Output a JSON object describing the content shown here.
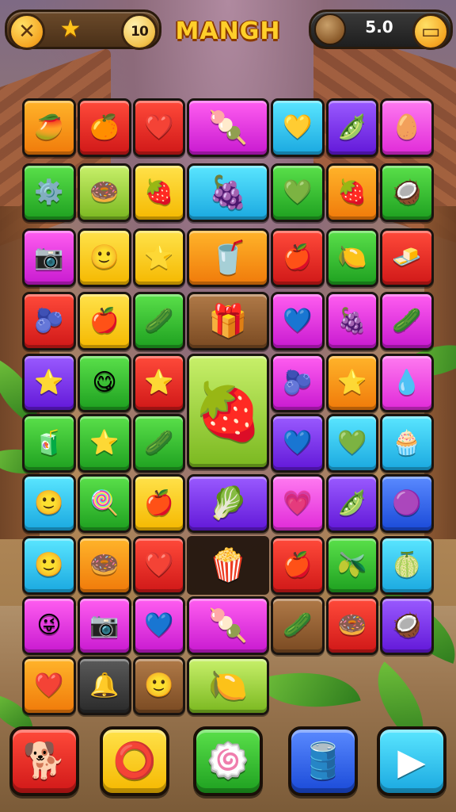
{
  "hud": {
    "close_icon": "✕",
    "star_icon": "★",
    "level": "10",
    "title": "MANGH",
    "coins": "5.0",
    "menu_icon": "▭"
  },
  "board": {
    "tiles": [
      {
        "id": "r1c1",
        "color": "orange",
        "glyph": "🥭",
        "icon": "mango-slice-icon"
      },
      {
        "id": "r1c2",
        "color": "red",
        "glyph": "🍊",
        "icon": "orange-fruit-icon"
      },
      {
        "id": "r1c3",
        "color": "red",
        "glyph": "❤️",
        "icon": "heart-icon"
      },
      {
        "id": "r1c4",
        "color": "magenta",
        "glyph": "🍡",
        "icon": "sushi-plate-icon",
        "span": "wide"
      },
      {
        "id": "r1c5",
        "color": "cyan",
        "glyph": "💛",
        "icon": "yellow-heart-icon"
      },
      {
        "id": "r1c6",
        "color": "purple",
        "glyph": "🫛",
        "icon": "pea-pod-icon"
      },
      {
        "id": "r1c7",
        "color": "pink",
        "glyph": "🥚",
        "icon": "egg-icon"
      },
      {
        "id": "r2c1",
        "color": "green",
        "glyph": "⚙️",
        "icon": "gear-device-icon"
      },
      {
        "id": "r2c2",
        "color": "lime",
        "glyph": "🍩",
        "icon": "donut-icon"
      },
      {
        "id": "r2c3",
        "color": "yellow",
        "glyph": "🍓",
        "icon": "jam-toast-icon"
      },
      {
        "id": "r2c4",
        "color": "cyan",
        "glyph": "🍇",
        "icon": "plum-icon",
        "span": "wide"
      },
      {
        "id": "r2c5",
        "color": "green",
        "glyph": "💚",
        "icon": "green-heart-icon"
      },
      {
        "id": "r2c6",
        "color": "orange",
        "glyph": "🍓",
        "icon": "strawberry-icon"
      },
      {
        "id": "r2c7",
        "color": "green",
        "glyph": "🥥",
        "icon": "coconut-icon"
      },
      {
        "id": "r3c1",
        "color": "magenta",
        "glyph": "📷",
        "icon": "camera-icon"
      },
      {
        "id": "r3c2",
        "color": "yellow",
        "glyph": "🙂",
        "icon": "smiley-icon"
      },
      {
        "id": "r3c3",
        "color": "yellow",
        "glyph": "⭐",
        "icon": "star-cookie-icon"
      },
      {
        "id": "r3c4",
        "color": "orange",
        "glyph": "🥤",
        "icon": "drink-mug-icon",
        "span": "wide"
      },
      {
        "id": "r3c5",
        "color": "red",
        "glyph": "🍎",
        "icon": "apple-icon"
      },
      {
        "id": "r3c6",
        "color": "green",
        "glyph": "🍋",
        "icon": "lemon-icon"
      },
      {
        "id": "r3c7",
        "color": "red",
        "glyph": "🧈",
        "icon": "butter-block-icon"
      },
      {
        "id": "r4c1",
        "color": "red",
        "glyph": "🫐",
        "icon": "blue-bell-icon"
      },
      {
        "id": "r4c2",
        "color": "yellow",
        "glyph": "🍎",
        "icon": "apple-icon"
      },
      {
        "id": "r4c3",
        "color": "green",
        "glyph": "🥒",
        "icon": "cucumber-icon"
      },
      {
        "id": "r4c4",
        "color": "brown",
        "glyph": "🎁",
        "icon": "gift-box-icon",
        "span": "wide"
      },
      {
        "id": "r4c5",
        "color": "magenta",
        "glyph": "💙",
        "icon": "blue-heart-icon"
      },
      {
        "id": "r4c6",
        "color": "magenta",
        "glyph": "🍇",
        "icon": "grape-icon"
      },
      {
        "id": "r4c7",
        "color": "magenta",
        "glyph": "🥒",
        "icon": "pickle-icon"
      },
      {
        "id": "r5c1",
        "color": "purple",
        "glyph": "⭐",
        "icon": "star-icon"
      },
      {
        "id": "r5c2",
        "color": "green",
        "glyph": "😋",
        "icon": "yum-face-icon"
      },
      {
        "id": "r5c3",
        "color": "red",
        "glyph": "⭐",
        "icon": "star-icon"
      },
      {
        "id": "r5c5",
        "color": "magenta",
        "glyph": "🫐",
        "icon": "blueberry-icon"
      },
      {
        "id": "r5c6",
        "color": "orange",
        "glyph": "⭐",
        "icon": "star-cookie-icon"
      },
      {
        "id": "r5c7",
        "color": "pink",
        "glyph": "💧",
        "icon": "jelly-drop-icon"
      },
      {
        "id": "r6c1",
        "color": "green",
        "glyph": "🧃",
        "icon": "juice-box-icon"
      },
      {
        "id": "r6c2",
        "color": "green",
        "glyph": "⭐",
        "icon": "star-icon"
      },
      {
        "id": "r6c3",
        "color": "green",
        "glyph": "🥒",
        "icon": "cucumber-icon"
      },
      {
        "id": "r6c5",
        "color": "purple",
        "glyph": "💙",
        "icon": "blue-heart-icon"
      },
      {
        "id": "r6c6",
        "color": "cyan",
        "glyph": "💚",
        "icon": "green-heart-icon"
      },
      {
        "id": "r6c7",
        "color": "cyan",
        "glyph": "🧁",
        "icon": "muffin-icon"
      },
      {
        "id": "r7c1",
        "color": "cyan",
        "glyph": "🙂",
        "icon": "smiley-icon"
      },
      {
        "id": "r7c2",
        "color": "green",
        "glyph": "🍭",
        "icon": "popsicle-icon"
      },
      {
        "id": "r7c3",
        "color": "yellow",
        "glyph": "🍎",
        "icon": "apple-icon"
      },
      {
        "id": "r7c4",
        "color": "purple",
        "glyph": "🥬",
        "icon": "green-pepper-icon",
        "span": "wide"
      },
      {
        "id": "r7c5",
        "color": "pink",
        "glyph": "💗",
        "icon": "pink-heart-icon"
      },
      {
        "id": "r7c6",
        "color": "purple",
        "glyph": "🫛",
        "icon": "pea-pod-icon"
      },
      {
        "id": "r7c7",
        "color": "blue",
        "glyph": "🟣",
        "icon": "purple-ball-icon"
      },
      {
        "id": "r8c1",
        "color": "cyan",
        "glyph": "🙂",
        "icon": "smiley-icon"
      },
      {
        "id": "r8c2",
        "color": "orange",
        "glyph": "🍩",
        "icon": "ring-donut-icon"
      },
      {
        "id": "r8c3",
        "color": "red",
        "glyph": "❤️",
        "icon": "heart-icon"
      },
      {
        "id": "r8c4",
        "color": "none",
        "glyph": "🍿",
        "icon": "popcorn-icon",
        "span": "wide"
      },
      {
        "id": "r8c5",
        "color": "red",
        "glyph": "🍎",
        "icon": "yellow-apple-icon"
      },
      {
        "id": "r8c6",
        "color": "green",
        "glyph": "🫒",
        "icon": "olive-icon"
      },
      {
        "id": "r8c7",
        "color": "cyan",
        "glyph": "🍈",
        "icon": "lime-icon"
      },
      {
        "id": "r9c1",
        "color": "magenta",
        "glyph": "😜",
        "icon": "silly-face-icon"
      },
      {
        "id": "r9c2",
        "color": "magenta",
        "glyph": "📷",
        "icon": "camera-lens-icon"
      },
      {
        "id": "r9c3",
        "color": "magenta",
        "glyph": "💙",
        "icon": "blue-heart-icon"
      },
      {
        "id": "r9c4",
        "color": "magenta",
        "glyph": "🍡",
        "icon": "sushi-plate-icon",
        "span": "wide"
      },
      {
        "id": "r9c5",
        "color": "brown",
        "glyph": "🥒",
        "icon": "leaf-pod-icon"
      },
      {
        "id": "r9c6",
        "color": "red",
        "glyph": "🍩",
        "icon": "ring-donut-icon"
      },
      {
        "id": "r9c7",
        "color": "purple",
        "glyph": "🥥",
        "icon": "coconut-half-icon"
      },
      {
        "id": "r10c1",
        "color": "orange",
        "glyph": "❤️",
        "icon": "heart-icon"
      },
      {
        "id": "r10c2",
        "color": "dark",
        "glyph": "🔔",
        "icon": "bell-icon"
      },
      {
        "id": "r10c3",
        "color": "brown",
        "glyph": "🙂",
        "icon": "smiley-icon"
      },
      {
        "id": "r10c4",
        "color": "lime",
        "glyph": "🍋",
        "icon": "lemon-icon",
        "span": "wide"
      }
    ],
    "big_tile": {
      "color": "lime",
      "glyph": "🍓",
      "icon": "strawberry-cup-icon"
    }
  },
  "boosters": [
    {
      "name": "dog-booster",
      "color": "red",
      "glyph": "🐕",
      "icon": "dog-icon"
    },
    {
      "name": "ring-booster",
      "color": "yellow",
      "glyph": "⭕",
      "icon": "ring-icon"
    },
    {
      "name": "swirl-booster",
      "color": "green",
      "glyph": "🍥",
      "icon": "swirl-candy-icon"
    },
    {
      "name": "barrel-booster",
      "color": "blue",
      "glyph": "🛢️",
      "icon": "barrel-icon"
    },
    {
      "name": "play-booster",
      "color": "cyan",
      "glyph": "▶",
      "icon": "play-icon"
    }
  ]
}
